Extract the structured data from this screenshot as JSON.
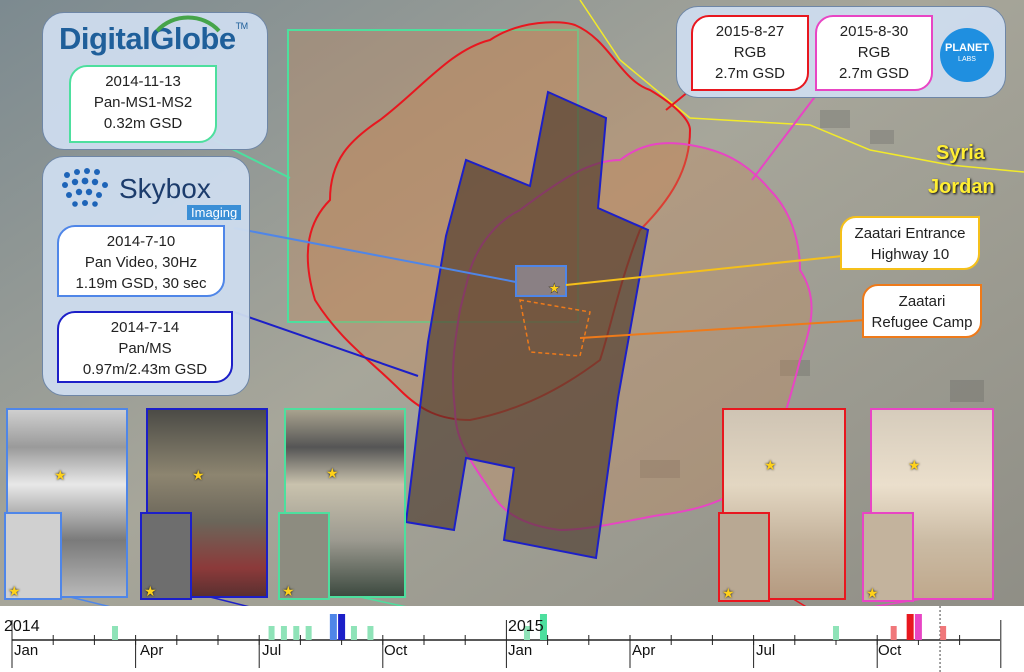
{
  "providers": {
    "digitalglobe": {
      "logo_text": "DigitalGlobe",
      "tm": "TM",
      "acquisition": {
        "date": "2014-11-13",
        "bands": "Pan-MS1-MS2",
        "gsd": "0.32m GSD"
      },
      "color": "#4ddf9e"
    },
    "skybox": {
      "logo_text": "Skybox",
      "logo_sub": "Imaging",
      "acquisitions": [
        {
          "date": "2014-7-10",
          "bands": "Pan Video, 30Hz",
          "gsd": "1.19m GSD,  30 sec",
          "color": "#4f86e8"
        },
        {
          "date": "2014-7-14",
          "bands": "Pan/MS",
          "gsd": "0.97m/2.43m GSD",
          "color": "#1c1fc8"
        }
      ]
    },
    "planet": {
      "logo_text": "PLANET",
      "logo_sub": "LABS",
      "acquisitions": [
        {
          "date": "2015-8-27",
          "bands": "RGB",
          "gsd": "2.7m GSD",
          "color": "#e8171f"
        },
        {
          "date": "2015-8-30",
          "bands": "RGB",
          "gsd": "2.7m GSD",
          "color": "#e845c4"
        }
      ]
    }
  },
  "map": {
    "border_labels": {
      "north": "Syria",
      "south": "Jordan"
    },
    "places": [
      {
        "name": "Zaatari Entrance",
        "detail": "Highway 10",
        "color": "#f5c01a"
      },
      {
        "name": "Zaatari",
        "detail": "Refugee Camp",
        "color": "#ee7a1a"
      }
    ]
  },
  "timeline": {
    "years": [
      "2014",
      "2015"
    ],
    "months": [
      "Jan",
      "Apr",
      "Jul",
      "Oct",
      "Jan",
      "Apr",
      "Jul",
      "Oct"
    ],
    "ticks": [
      {
        "month": 2.5,
        "color": "#8fe3b8"
      },
      {
        "month": 6.3,
        "color": "#8fe3b8"
      },
      {
        "month": 6.6,
        "color": "#8fe3b8"
      },
      {
        "month": 6.9,
        "color": "#8fe3b8"
      },
      {
        "month": 7.2,
        "color": "#8fe3b8"
      },
      {
        "month": 8.3,
        "color": "#8fe3b8"
      },
      {
        "month": 8.7,
        "color": "#8fe3b8"
      },
      {
        "month": 12.5,
        "color": "#8fe3b8"
      },
      {
        "month": 20.0,
        "color": "#8fe3b8"
      },
      {
        "month": 21.4,
        "color": "#f0777a"
      },
      {
        "month": 22.6,
        "color": "#f0777a"
      },
      {
        "month": 7.8,
        "color": "#4f86e8",
        "tall": true
      },
      {
        "month": 8.0,
        "color": "#1c1fc8",
        "tall": true
      },
      {
        "month": 12.9,
        "color": "#4ddf9e",
        "tall": true
      },
      {
        "month": 21.8,
        "color": "#e8171f",
        "tall": true
      },
      {
        "month": 22.0,
        "color": "#e845c4",
        "tall": true
      }
    ]
  }
}
